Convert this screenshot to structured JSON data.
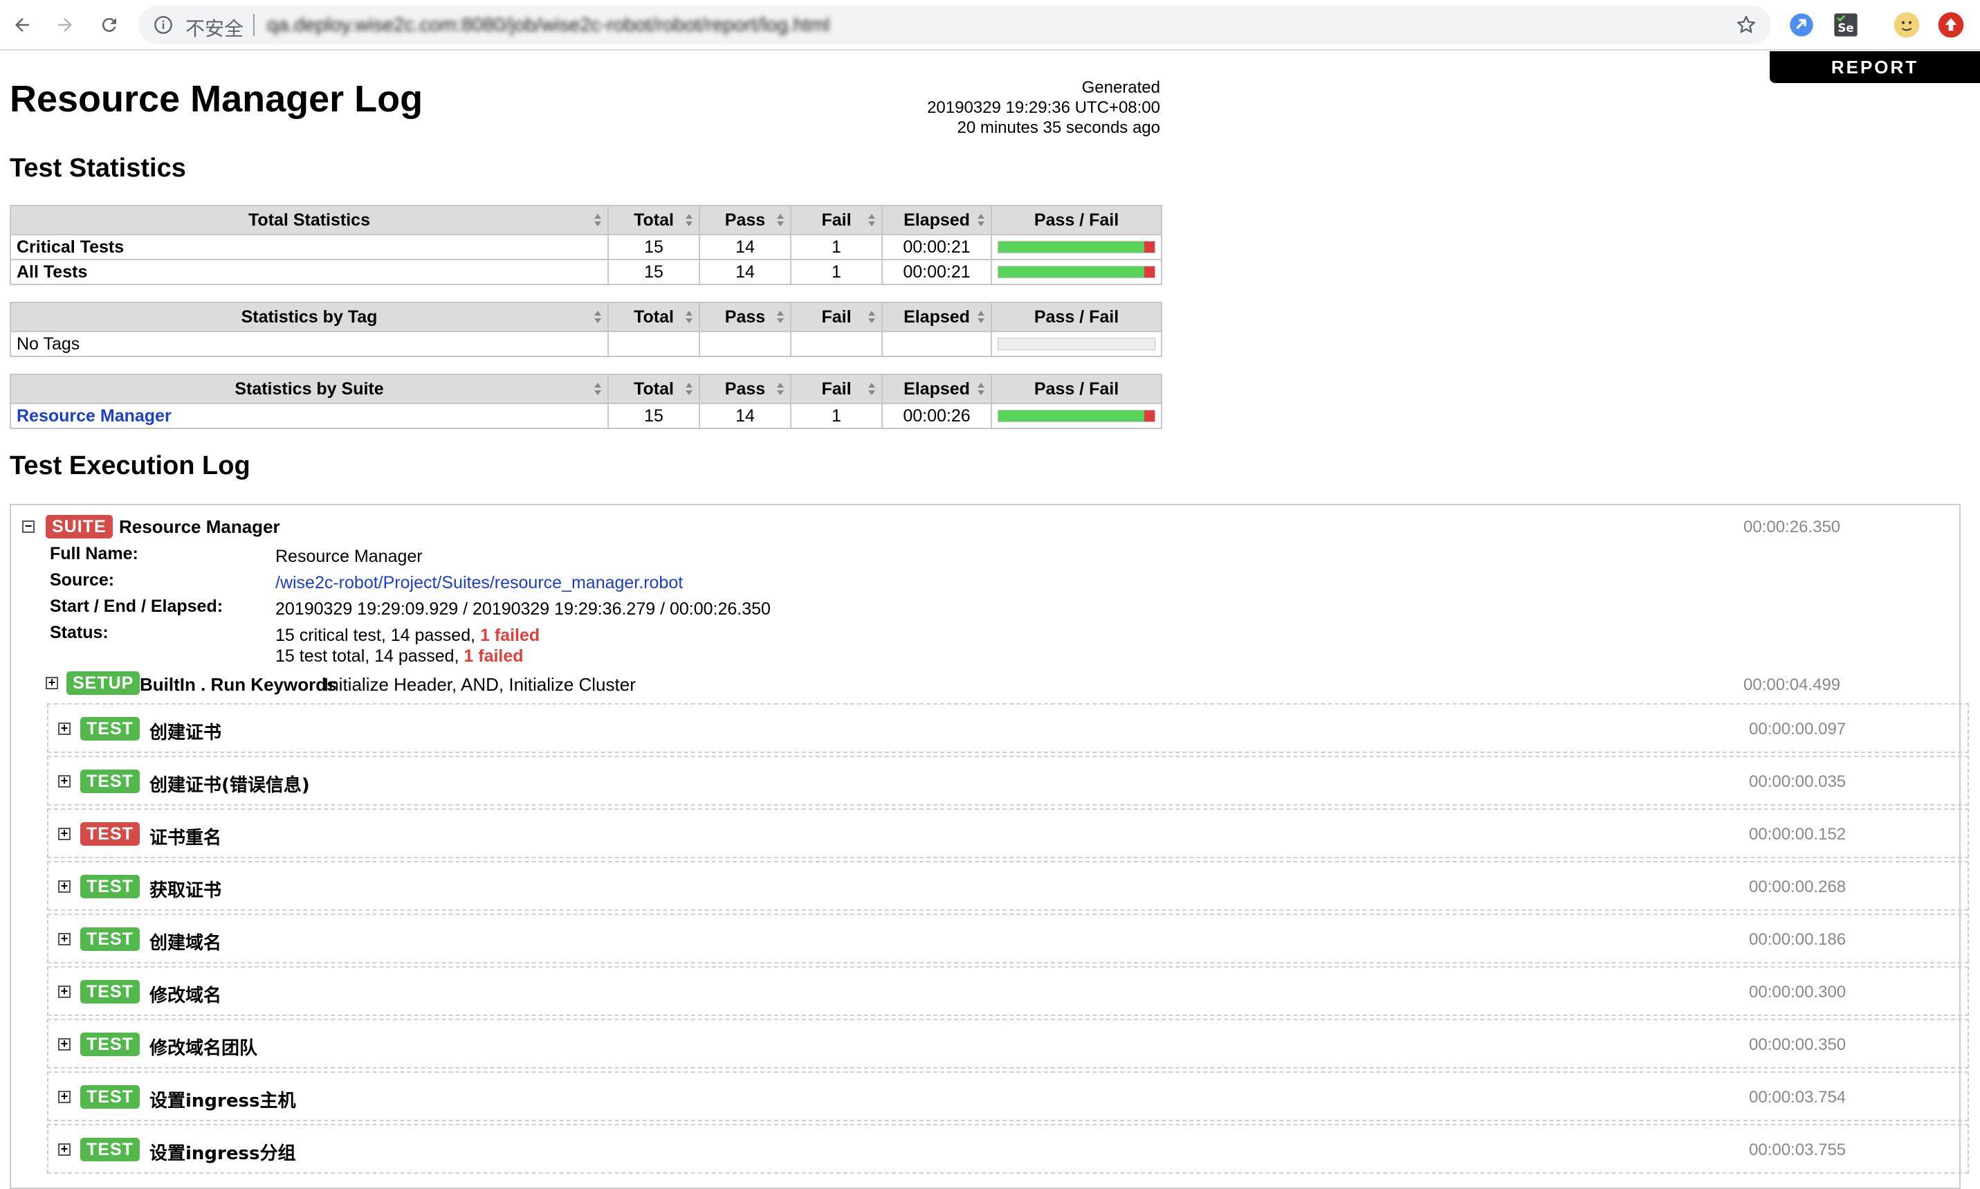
{
  "browser": {
    "insecure_label": "不安全",
    "url": "qa.deploy.wise2c.com:8080/job/wise2c-robot/robot/report/log.html"
  },
  "report_tab": "REPORT",
  "title": "Resource Manager Log",
  "generated": {
    "label": "Generated",
    "timestamp": "20190329 19:29:36 UTC+08:00",
    "ago": "20 minutes 35 seconds ago"
  },
  "statistics_heading": "Test Statistics",
  "columns": [
    "Total",
    "Pass",
    "Fail",
    "Elapsed",
    "Pass / Fail"
  ],
  "total_statistics": {
    "header": "Total Statistics",
    "rows": [
      {
        "name": "Critical Tests",
        "total": "15",
        "pass": "14",
        "fail": "1",
        "elapsed": "00:00:21",
        "pass_fraction": 0.933
      },
      {
        "name": "All Tests",
        "total": "15",
        "pass": "14",
        "fail": "1",
        "elapsed": "00:00:21",
        "pass_fraction": 0.933
      }
    ]
  },
  "tag_statistics": {
    "header": "Statistics by Tag",
    "rows": [
      {
        "name": "No Tags",
        "total": "",
        "pass": "",
        "fail": "",
        "elapsed": ""
      }
    ]
  },
  "suite_statistics": {
    "header": "Statistics by Suite",
    "rows": [
      {
        "name": "Resource Manager",
        "total": "15",
        "pass": "14",
        "fail": "1",
        "elapsed": "00:00:26",
        "pass_fraction": 0.933
      }
    ]
  },
  "execution_heading": "Test Execution Log",
  "suite": {
    "label": "SUITE",
    "name": "Resource Manager",
    "elapsed": "00:00:26.350",
    "collapse_symbol": "−",
    "meta": {
      "full_name_key": "Full Name:",
      "full_name": "Resource Manager",
      "source_key": "Source:",
      "source": "/wise2c-robot/Project/Suites/resource_manager.robot",
      "times_key": "Start / End / Elapsed:",
      "times": "20190329 19:29:09.929 / 20190329 19:29:36.279 / 00:00:26.350",
      "status_key": "Status:",
      "status_line1_prefix": "15 critical test, 14 passed, ",
      "status_line1_fail": "1 failed",
      "status_line2_prefix": "15 test total, 14 passed, ",
      "status_line2_fail": "1 failed"
    }
  },
  "setup": {
    "label": "SETUP",
    "keyword": "BuiltIn . Run Keywords",
    "args": "Initialize Header, AND, Initialize Cluster",
    "elapsed": "00:00:04.499",
    "expand_symbol": "+"
  },
  "tests": [
    {
      "label": "TEST",
      "name": "创建证书",
      "elapsed": "00:00:00.097",
      "status": "pass"
    },
    {
      "label": "TEST",
      "name": "创建证书(错误信息)",
      "elapsed": "00:00:00.035",
      "status": "pass"
    },
    {
      "label": "TEST",
      "name": "证书重名",
      "elapsed": "00:00:00.152",
      "status": "fail"
    },
    {
      "label": "TEST",
      "name": "获取证书",
      "elapsed": "00:00:00.268",
      "status": "pass"
    },
    {
      "label": "TEST",
      "name": "创建域名",
      "elapsed": "00:00:00.186",
      "status": "pass"
    },
    {
      "label": "TEST",
      "name": "修改域名",
      "elapsed": "00:00:00.300",
      "status": "pass"
    },
    {
      "label": "TEST",
      "name": "修改域名团队",
      "elapsed": "00:00:00.350",
      "status": "pass"
    },
    {
      "label": "TEST",
      "name": "设置ingress主机",
      "elapsed": "00:00:03.754",
      "status": "pass"
    },
    {
      "label": "TEST",
      "name": "设置ingress分组",
      "elapsed": "00:00:03.755",
      "status": "pass"
    }
  ],
  "colors": {
    "pass": "#53b84c",
    "fail": "#d44b47",
    "link": "#1a3fc9"
  }
}
